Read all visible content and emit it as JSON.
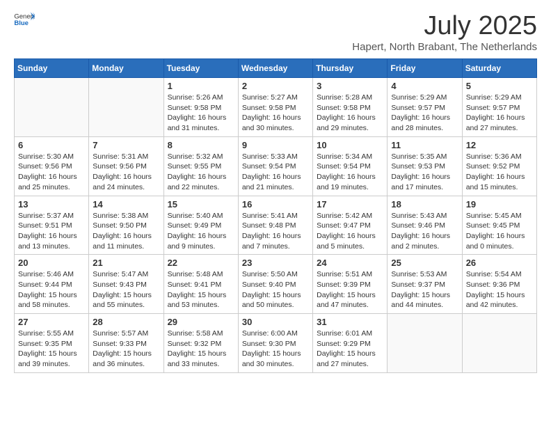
{
  "header": {
    "logo_general": "General",
    "logo_blue": "Blue",
    "title": "July 2025",
    "subtitle": "Hapert, North Brabant, The Netherlands"
  },
  "weekdays": [
    "Sunday",
    "Monday",
    "Tuesday",
    "Wednesday",
    "Thursday",
    "Friday",
    "Saturday"
  ],
  "weeks": [
    [
      {
        "day": "",
        "info": ""
      },
      {
        "day": "",
        "info": ""
      },
      {
        "day": "1",
        "info": "Sunrise: 5:26 AM\nSunset: 9:58 PM\nDaylight: 16 hours and 31 minutes."
      },
      {
        "day": "2",
        "info": "Sunrise: 5:27 AM\nSunset: 9:58 PM\nDaylight: 16 hours and 30 minutes."
      },
      {
        "day": "3",
        "info": "Sunrise: 5:28 AM\nSunset: 9:58 PM\nDaylight: 16 hours and 29 minutes."
      },
      {
        "day": "4",
        "info": "Sunrise: 5:29 AM\nSunset: 9:57 PM\nDaylight: 16 hours and 28 minutes."
      },
      {
        "day": "5",
        "info": "Sunrise: 5:29 AM\nSunset: 9:57 PM\nDaylight: 16 hours and 27 minutes."
      }
    ],
    [
      {
        "day": "6",
        "info": "Sunrise: 5:30 AM\nSunset: 9:56 PM\nDaylight: 16 hours and 25 minutes."
      },
      {
        "day": "7",
        "info": "Sunrise: 5:31 AM\nSunset: 9:56 PM\nDaylight: 16 hours and 24 minutes."
      },
      {
        "day": "8",
        "info": "Sunrise: 5:32 AM\nSunset: 9:55 PM\nDaylight: 16 hours and 22 minutes."
      },
      {
        "day": "9",
        "info": "Sunrise: 5:33 AM\nSunset: 9:54 PM\nDaylight: 16 hours and 21 minutes."
      },
      {
        "day": "10",
        "info": "Sunrise: 5:34 AM\nSunset: 9:54 PM\nDaylight: 16 hours and 19 minutes."
      },
      {
        "day": "11",
        "info": "Sunrise: 5:35 AM\nSunset: 9:53 PM\nDaylight: 16 hours and 17 minutes."
      },
      {
        "day": "12",
        "info": "Sunrise: 5:36 AM\nSunset: 9:52 PM\nDaylight: 16 hours and 15 minutes."
      }
    ],
    [
      {
        "day": "13",
        "info": "Sunrise: 5:37 AM\nSunset: 9:51 PM\nDaylight: 16 hours and 13 minutes."
      },
      {
        "day": "14",
        "info": "Sunrise: 5:38 AM\nSunset: 9:50 PM\nDaylight: 16 hours and 11 minutes."
      },
      {
        "day": "15",
        "info": "Sunrise: 5:40 AM\nSunset: 9:49 PM\nDaylight: 16 hours and 9 minutes."
      },
      {
        "day": "16",
        "info": "Sunrise: 5:41 AM\nSunset: 9:48 PM\nDaylight: 16 hours and 7 minutes."
      },
      {
        "day": "17",
        "info": "Sunrise: 5:42 AM\nSunset: 9:47 PM\nDaylight: 16 hours and 5 minutes."
      },
      {
        "day": "18",
        "info": "Sunrise: 5:43 AM\nSunset: 9:46 PM\nDaylight: 16 hours and 2 minutes."
      },
      {
        "day": "19",
        "info": "Sunrise: 5:45 AM\nSunset: 9:45 PM\nDaylight: 16 hours and 0 minutes."
      }
    ],
    [
      {
        "day": "20",
        "info": "Sunrise: 5:46 AM\nSunset: 9:44 PM\nDaylight: 15 hours and 58 minutes."
      },
      {
        "day": "21",
        "info": "Sunrise: 5:47 AM\nSunset: 9:43 PM\nDaylight: 15 hours and 55 minutes."
      },
      {
        "day": "22",
        "info": "Sunrise: 5:48 AM\nSunset: 9:41 PM\nDaylight: 15 hours and 53 minutes."
      },
      {
        "day": "23",
        "info": "Sunrise: 5:50 AM\nSunset: 9:40 PM\nDaylight: 15 hours and 50 minutes."
      },
      {
        "day": "24",
        "info": "Sunrise: 5:51 AM\nSunset: 9:39 PM\nDaylight: 15 hours and 47 minutes."
      },
      {
        "day": "25",
        "info": "Sunrise: 5:53 AM\nSunset: 9:37 PM\nDaylight: 15 hours and 44 minutes."
      },
      {
        "day": "26",
        "info": "Sunrise: 5:54 AM\nSunset: 9:36 PM\nDaylight: 15 hours and 42 minutes."
      }
    ],
    [
      {
        "day": "27",
        "info": "Sunrise: 5:55 AM\nSunset: 9:35 PM\nDaylight: 15 hours and 39 minutes."
      },
      {
        "day": "28",
        "info": "Sunrise: 5:57 AM\nSunset: 9:33 PM\nDaylight: 15 hours and 36 minutes."
      },
      {
        "day": "29",
        "info": "Sunrise: 5:58 AM\nSunset: 9:32 PM\nDaylight: 15 hours and 33 minutes."
      },
      {
        "day": "30",
        "info": "Sunrise: 6:00 AM\nSunset: 9:30 PM\nDaylight: 15 hours and 30 minutes."
      },
      {
        "day": "31",
        "info": "Sunrise: 6:01 AM\nSunset: 9:29 PM\nDaylight: 15 hours and 27 minutes."
      },
      {
        "day": "",
        "info": ""
      },
      {
        "day": "",
        "info": ""
      }
    ]
  ]
}
